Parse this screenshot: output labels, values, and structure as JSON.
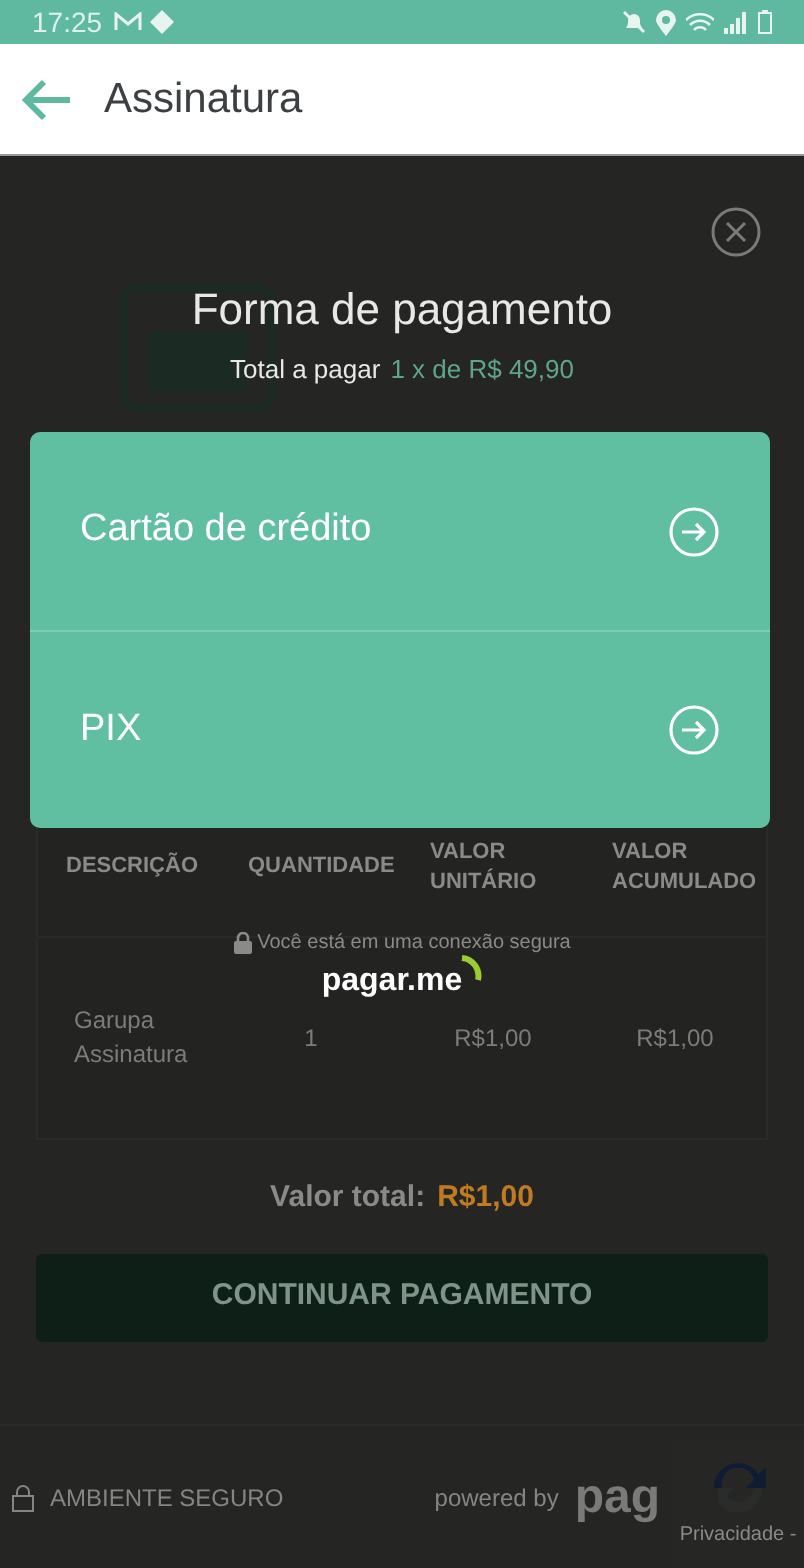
{
  "status_bar": {
    "time": "17:25"
  },
  "app_bar": {
    "title": "Assinatura"
  },
  "checkout": {
    "table": {
      "columns": [
        "DESCRIÇÃO",
        "QUANTIDADE",
        "VALOR UNITÁRIO",
        "VALOR ACUMULADO"
      ],
      "rows": [
        [
          "Garupa Assinatura",
          "1",
          "R$1,00",
          "R$1,00"
        ]
      ]
    },
    "total_label": "Valor total:",
    "total_value": "R$1,00",
    "continue_button": "CONTINUAR PAGAMENTO",
    "secure_label": "AMBIENTE SEGURO",
    "powered_by": "powered by",
    "powered_brand": "pag",
    "recaptcha": "Privacidade -"
  },
  "modal": {
    "title": "Forma de pagamento",
    "total_label": "Total a pagar",
    "total_value": "1 x de R$ 49,90",
    "options": [
      {
        "label": "Cartão de crédito"
      },
      {
        "label": "PIX"
      }
    ],
    "secure_note": "Você está em uma conexão segura",
    "brand": "pagar.me"
  }
}
